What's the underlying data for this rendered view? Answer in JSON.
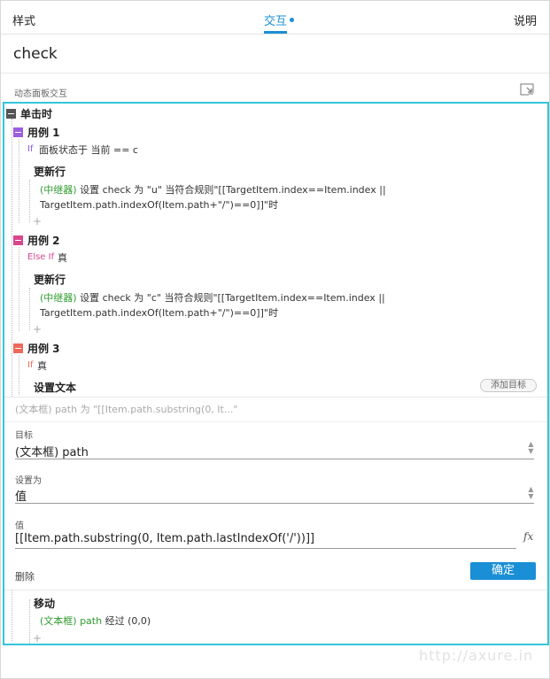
{
  "tabs": {
    "style": "样式",
    "interact": "交互",
    "help": "说明"
  },
  "widget_name": "check",
  "section_title": "动态面板交互",
  "event": {
    "label": "单击时"
  },
  "cases": [
    {
      "label": "用例 1",
      "condition_kw": "If",
      "condition_text": "面板状态于 当前 == c",
      "action_title": "更新行",
      "target": "(中继器)",
      "line1": "设置 check 为 \"u\" 当符合规则\"[[TargetItem.index==Item.index ||",
      "line2": "TargetItem.path.indexOf(Item.path+\"/\")==0]]\"时"
    },
    {
      "label": "用例 2",
      "condition_kw": "Else If",
      "condition_text": "真",
      "action_title": "更新行",
      "target": "(中继器)",
      "line1": "设置 check 为 \"c\" 当符合规则\"[[TargetItem.index==Item.index ||",
      "line2": "TargetItem.path.indexOf(Item.path+\"/\")==0]]\"时"
    },
    {
      "label": "用例 3",
      "condition_kw": "If",
      "condition_text": "真",
      "action_title": "设置文本",
      "add_target": "添加目标",
      "summary": "(文本框) path 为 \"[[Item.path.substring(0, It...\"",
      "move_title": "移动",
      "move_target": "(文本框) path",
      "move_text": "经过 (0,0)"
    }
  ],
  "form": {
    "target_label": "目标",
    "target_value": "(文本框) path",
    "set_as_label": "设置为",
    "set_as_value": "值",
    "value_label": "值",
    "value_text": "[[Item.path.substring(0, Item.path.lastIndexOf('/'))]]",
    "fx": "fx",
    "delete": "删除",
    "confirm": "确定"
  },
  "plus": "+",
  "watermark": "http://axure.in",
  "colors": {
    "accent": "#1a8fd6",
    "highlight": "#34c6dc",
    "case1": "#9b5fe0",
    "case2": "#d9468c",
    "case3": "#ef6a5b",
    "target": "#2f9b2f"
  },
  "icons": [
    "expand-panel-icon",
    "collapse-icon",
    "fx-icon",
    "spinner-icon"
  ]
}
